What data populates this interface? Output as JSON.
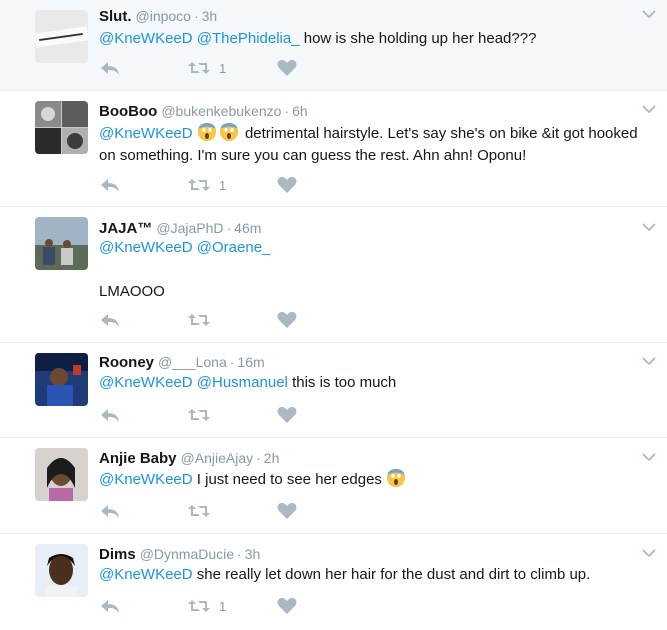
{
  "tweets": [
    {
      "name": "Slut.",
      "handle": "@inpoco",
      "time": "3h",
      "mentions": [
        "@KneWKeeD",
        "@ThePhidelia_"
      ],
      "text": "how is she holding up her head???",
      "retweets": "1"
    },
    {
      "name": "BooBoo",
      "handle": "@bukenkebukenzo",
      "time": "6h",
      "mentions": [
        "@KneWKeeD"
      ],
      "emoji": "face-screaming-in-fear-emoji",
      "text": "detrimental hairstyle. Let's say she's on bike &it got hooked",
      "text2": "on something. I'm sure you can guess the rest. Ahn ahn! Oponu!",
      "retweets": "1"
    },
    {
      "name": "JAJA™",
      "handle": "@JajaPhD",
      "time": "46m",
      "mentions": [
        "@KneWKeeD",
        "@Oraene_"
      ],
      "text": "LMAOOO",
      "retweets": ""
    },
    {
      "name": "Rooney",
      "handle": "@___Lona",
      "time": "16m",
      "mentions": [
        "@KneWKeeD",
        "@Husmanuel"
      ],
      "text": "this is too much",
      "retweets": ""
    },
    {
      "name": "Anjie Baby",
      "handle": "@AnjieAjay",
      "time": "2h",
      "mentions": [
        "@KneWKeeD"
      ],
      "text": "I just need to see her edges",
      "emoji": "face-screaming-in-fear-emoji",
      "retweets": ""
    },
    {
      "name": "Dims",
      "handle": "@DynmaDucie",
      "time": "3h",
      "mentions": [
        "@KneWKeeD"
      ],
      "text": "she really let down her hair for the dust and dirt to climb up.",
      "retweets": "1"
    }
  ],
  "separator": "·",
  "icons": {
    "reply": "reply-icon",
    "retweet": "retweet-icon",
    "like": "heart-icon",
    "more": "chevron-down-icon"
  },
  "colors": {
    "link": "#1b95e0",
    "muted": "#8899a6",
    "icon": "#aab8c2",
    "highlight_bg": "#f5f8fa",
    "border": "#e6ecf0"
  }
}
